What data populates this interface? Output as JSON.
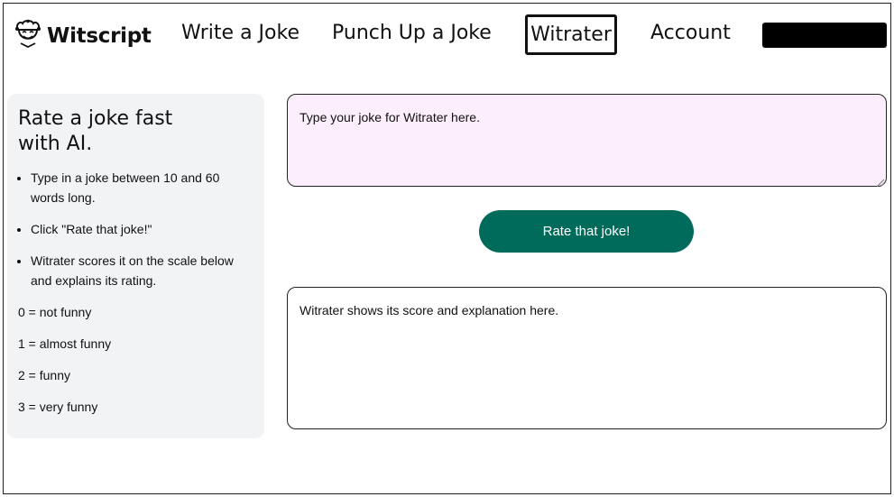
{
  "header": {
    "logo_text": "Witscript",
    "nav": {
      "write": "Write a Joke",
      "punch": "Punch Up a Joke",
      "witrater": "Witrater",
      "account": "Account"
    }
  },
  "sidebar": {
    "title": "Rate a joke fast with AI.",
    "steps": [
      "Type in a joke between 10 and 60 words long.",
      "Click \"Rate that joke!\"",
      "Witrater scores it on the scale below and explains its rating."
    ],
    "scale": [
      "0 = not funny",
      "1 = almost funny",
      "2 = funny",
      "3 = very funny"
    ]
  },
  "main": {
    "joke_placeholder": "Type your joke for Witrater here.",
    "rate_button": "Rate that joke!",
    "output_placeholder": "Witrater shows its score and explanation here."
  },
  "colors": {
    "button_bg": "#006b5a",
    "input_bg": "#fdeefd",
    "sidebar_bg": "#f2f3f5"
  }
}
